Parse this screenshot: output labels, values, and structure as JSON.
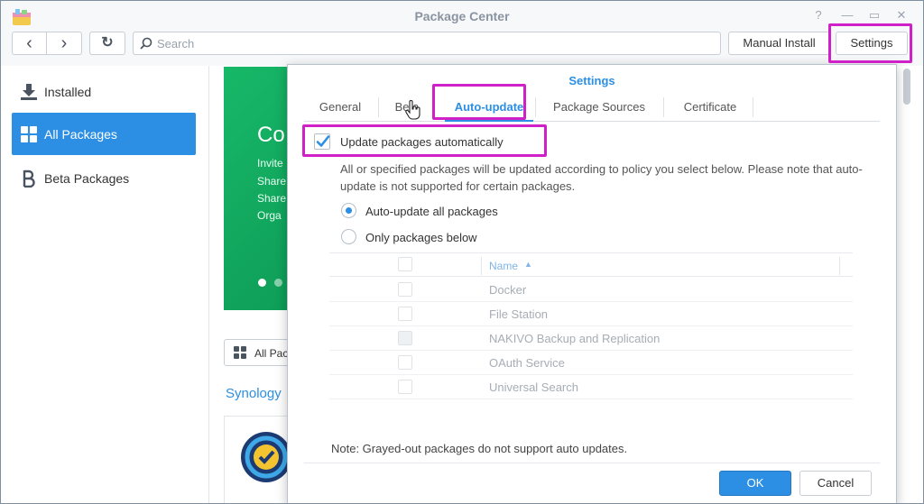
{
  "window": {
    "title": "Package Center"
  },
  "window_controls": {
    "help": "?",
    "minimize": "—",
    "maximize": "▭",
    "close": "✕"
  },
  "toolbar": {
    "back_glyph": "‹",
    "forward_glyph": "›",
    "refresh_glyph": "↻",
    "search_placeholder": "Search",
    "search_value": "",
    "manual_install_label": "Manual Install",
    "settings_label": "Settings"
  },
  "sidebar": {
    "items": [
      {
        "label": "Installed",
        "icon": "download-icon"
      },
      {
        "label": "All Packages",
        "icon": "grid-icon",
        "active": true
      },
      {
        "label": "Beta Packages",
        "icon": "beta-icon"
      }
    ]
  },
  "main": {
    "banner_title": "Co",
    "banner_lines": [
      "Invite",
      "Share",
      "Share",
      "Orga"
    ],
    "filter_label": "All Pac",
    "section_label": "Synology"
  },
  "dialog": {
    "title": "Settings",
    "tabs": [
      {
        "label": "General"
      },
      {
        "label": "Beta"
      },
      {
        "label": "Auto-update",
        "active": true
      },
      {
        "label": "Package Sources"
      },
      {
        "label": "Certificate"
      }
    ],
    "auto_update_label": "Update packages automatically",
    "auto_update_checked": true,
    "description": "All or specified packages will be updated according to policy you select below. Please note that auto-update is not supported for certain packages.",
    "radio_all_label": "Auto-update all packages",
    "radio_some_label": "Only packages below",
    "selected_option": "all",
    "table": {
      "name_header": "Name",
      "sort_glyph": "▲",
      "rows": [
        {
          "name": "Docker"
        },
        {
          "name": "File Station"
        },
        {
          "name": "NAKIVO Backup and Replication"
        },
        {
          "name": "OAuth Service"
        },
        {
          "name": "Universal Search"
        }
      ]
    },
    "note": "Note: Grayed-out packages do not support auto updates.",
    "ok_label": "OK",
    "cancel_label": "Cancel"
  },
  "colors": {
    "accent": "#2c8fe3",
    "highlight": "#d020c8",
    "banner_green": "#17b868"
  }
}
